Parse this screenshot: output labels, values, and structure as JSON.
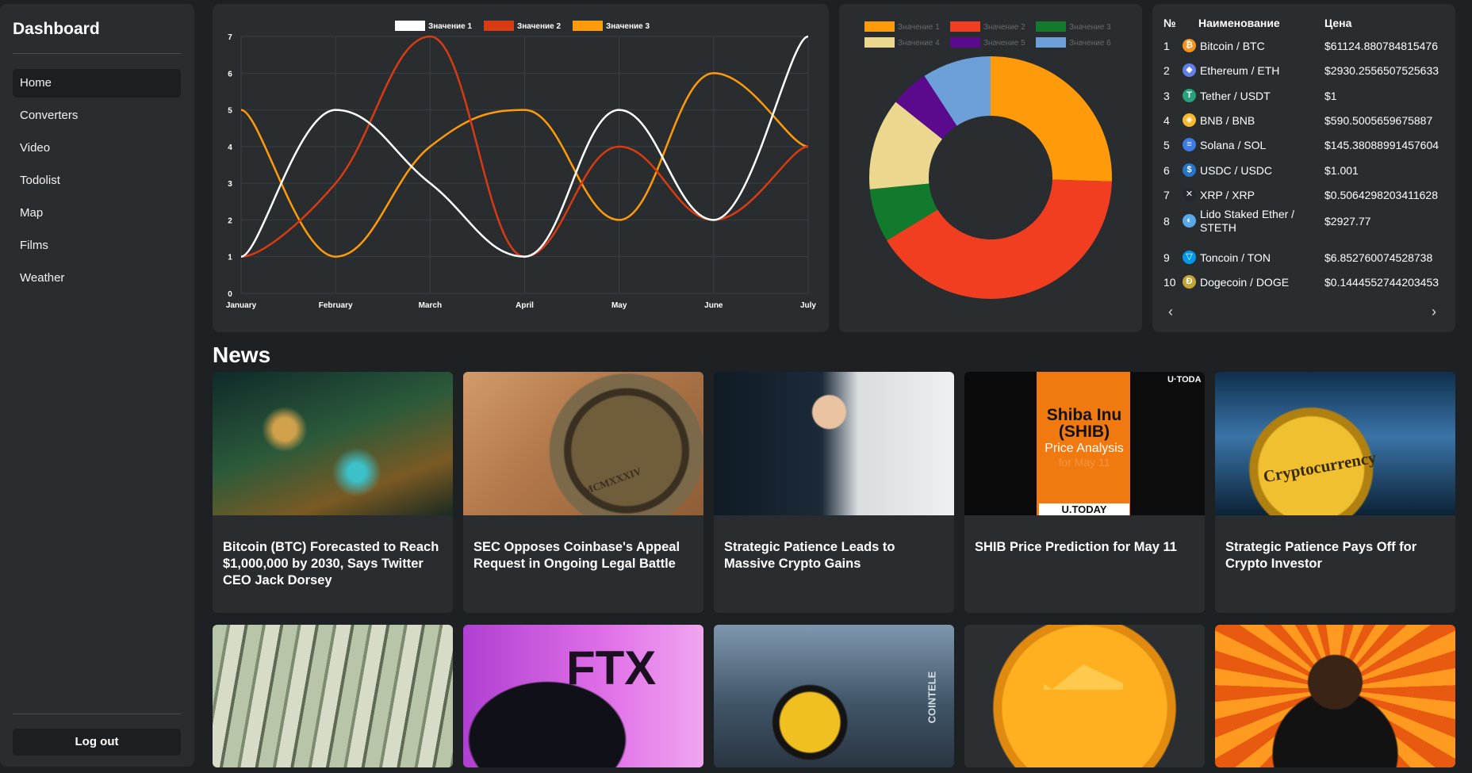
{
  "sidebar": {
    "brand": "Dashboard",
    "nav": [
      {
        "label": "Home",
        "active": true
      },
      {
        "label": "Converters"
      },
      {
        "label": "Video"
      },
      {
        "label": "Todolist"
      },
      {
        "label": "Map"
      },
      {
        "label": "Films"
      },
      {
        "label": "Weather"
      }
    ],
    "logout": "Log out"
  },
  "chart_data": [
    {
      "type": "line",
      "categories": [
        "January",
        "February",
        "March",
        "April",
        "May",
        "June",
        "July"
      ],
      "ylim": [
        0,
        7
      ],
      "yticks": [
        "0",
        "1",
        "2",
        "3",
        "4",
        "5",
        "6",
        "7"
      ],
      "legend_position": "top",
      "grid": true,
      "series": [
        {
          "name": "Значение 1",
          "color": "#ffffff",
          "values": [
            1,
            5,
            3,
            1,
            5,
            2,
            7
          ]
        },
        {
          "name": "Значение 2",
          "color": "#d83a12",
          "values": [
            1,
            3,
            7,
            1,
            4,
            2,
            4
          ]
        },
        {
          "name": "Значение 3",
          "color": "#ff9a0a",
          "values": [
            5,
            1,
            4,
            5,
            2,
            6,
            4
          ]
        }
      ]
    },
    {
      "type": "pie",
      "variant": "doughnut",
      "legend_position": "top",
      "categories": [
        "Значение 1",
        "Значение 2",
        "Значение 3",
        "Значение 4",
        "Значение 5",
        "Значение 6"
      ],
      "values": [
        25,
        40,
        7,
        12,
        5,
        9
      ],
      "colors": [
        "#ff9a0a",
        "#f13e20",
        "#117a2c",
        "#ebd88e",
        "#5b0a8e",
        "#6d9fd8"
      ]
    }
  ],
  "crypto_table": {
    "headers": {
      "num": "№",
      "name": "Наименование",
      "price": "Цена"
    },
    "rows": [
      {
        "num": "1",
        "icon": "bitcoin-icon",
        "glyph": "₿",
        "color": "#f7931a",
        "name": "Bitcoin / BTC",
        "price": "$61124.880784815476"
      },
      {
        "num": "2",
        "icon": "ethereum-icon",
        "glyph": "◆",
        "color": "#627eea",
        "name": "Ethereum / ETH",
        "price": "$2930.2556507525633"
      },
      {
        "num": "3",
        "icon": "tether-icon",
        "glyph": "T",
        "color": "#26a17b",
        "name": "Tether / USDT",
        "price": "$1"
      },
      {
        "num": "4",
        "icon": "bnb-icon",
        "glyph": "◈",
        "color": "#f3ba2f",
        "name": "BNB / BNB",
        "price": "$590.5005659675887"
      },
      {
        "num": "5",
        "icon": "solana-icon",
        "glyph": "≡",
        "color": "#3e7be6",
        "name": "Solana / SOL",
        "price": "$145.38088991457604"
      },
      {
        "num": "6",
        "icon": "usdc-icon",
        "glyph": "$",
        "color": "#2775ca",
        "name": "USDC / USDC",
        "price": "$1.001"
      },
      {
        "num": "7",
        "icon": "xrp-icon",
        "glyph": "✕",
        "color": "#23292f",
        "name": "XRP / XRP",
        "price": "$0.5064298203411628"
      },
      {
        "num": "8",
        "icon": "lido-icon",
        "glyph": "◐",
        "color": "#59a9e8",
        "name": "Lido Staked Ether / STETH",
        "price": "$2927.77"
      },
      {
        "num": "9",
        "icon": "toncoin-icon",
        "glyph": "▽",
        "color": "#0098ea",
        "name": "Toncoin / TON",
        "price": "$6.852760074528738"
      },
      {
        "num": "10",
        "icon": "dogecoin-icon",
        "glyph": "Ð",
        "color": "#c2a633",
        "name": "Dogecoin / DOGE",
        "price": "$0.1444552744203453"
      }
    ],
    "prev": "‹",
    "next": "›"
  },
  "news": {
    "title": "News",
    "items": [
      {
        "title": "Bitcoin (BTC) Forecasted to Reach $1,000,000 by 2030, Says Twitter CEO Jack Dorsey",
        "image": "fantasy-crypto-scene-image"
      },
      {
        "title": "SEC Opposes Coinbase's Appeal Request in Ongoing Legal Battle",
        "image": "sec-seal-image",
        "overlay": "MCMXXXIV"
      },
      {
        "title": "Strategic Patience Leads to Massive Crypto Gains",
        "image": "man-on-phone-image"
      },
      {
        "title": "SHIB Price Prediction for May 11",
        "image": "shiba-inu-analysis-image",
        "overlay_title": "Shiba Inu (SHIB)",
        "overlay_sub": "Price Analysis",
        "overlay_date": "for May 11",
        "overlay_brand": "U.TODAY",
        "overlay_brand_top": "U·TODA"
      },
      {
        "title": "Strategic Patience Pays Off for Crypto Investor",
        "image": "cryptocurrency-coin-image",
        "overlay": "Cryptocurrency"
      },
      {
        "title": "",
        "image": "dollar-bills-image"
      },
      {
        "title": "",
        "image": "ftx-phone-image",
        "overlay": "FTX"
      },
      {
        "title": "",
        "image": "airplane-coin-image",
        "overlay": "COINTELE"
      },
      {
        "title": "",
        "image": "bank-coin-image"
      },
      {
        "title": "",
        "image": "comic-bitcoin-man-image"
      }
    ]
  }
}
